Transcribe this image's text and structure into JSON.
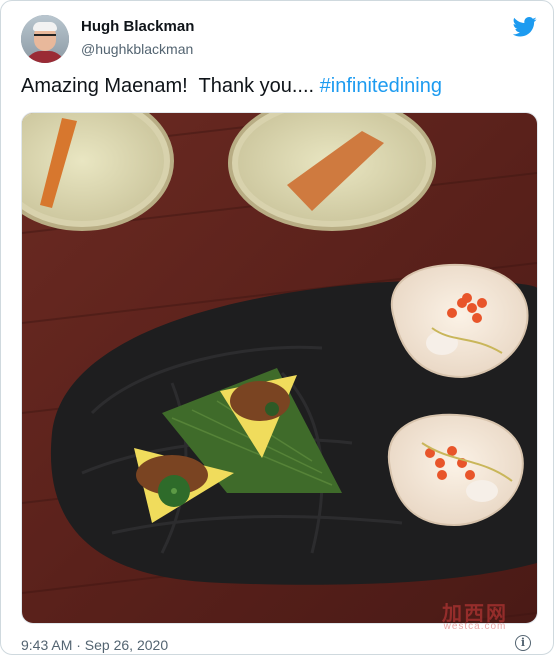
{
  "tweet": {
    "author_name": "Hugh Blackman",
    "author_handle": "@hughkblackman",
    "text_plain": "Amazing Maenam!  Thank you.... ",
    "hashtag": "#infinitedining",
    "timestamp": "9:43 AM · Sep 26, 2020",
    "info_glyph": "i"
  },
  "watermark": {
    "text": "加西网",
    "url": "westca.com"
  },
  "colors": {
    "accent": "#1d9bf0",
    "text": "#0f1419",
    "muted": "#536471"
  },
  "icons": {
    "brand": "twitter-bird-icon",
    "info": "info-icon"
  }
}
